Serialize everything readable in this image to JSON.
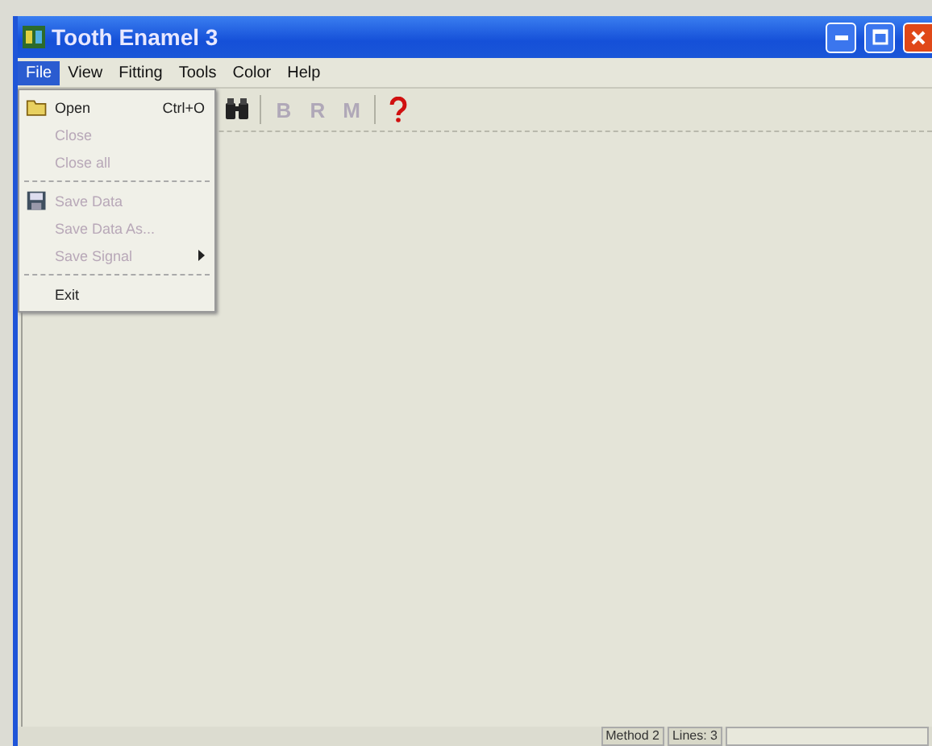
{
  "window": {
    "title": "Tooth Enamel 3"
  },
  "menu_bar": [
    {
      "label": "File",
      "selected": true
    },
    {
      "label": "View",
      "selected": false
    },
    {
      "label": "Fitting",
      "selected": false
    },
    {
      "label": "Tools",
      "selected": false
    },
    {
      "label": "Color",
      "selected": false
    },
    {
      "label": "Help",
      "selected": false
    }
  ],
  "toolbar": [
    {
      "kind": "binoculars"
    },
    {
      "kind": "separator"
    },
    {
      "kind": "letter",
      "label": "B",
      "disabled": true
    },
    {
      "kind": "letter",
      "label": "R",
      "disabled": true
    },
    {
      "kind": "letter",
      "label": "M",
      "disabled": true
    },
    {
      "kind": "separator"
    },
    {
      "kind": "help"
    }
  ],
  "file_menu": [
    {
      "kind": "folder",
      "label": "Open",
      "shortcut": "Ctrl+O",
      "disabled": false
    },
    {
      "kind": "item",
      "label": "Close",
      "disabled": true
    },
    {
      "kind": "item",
      "label": "Close all",
      "disabled": true
    },
    {
      "kind": "separator"
    },
    {
      "kind": "disk",
      "label": "Save Data",
      "disabled": true
    },
    {
      "kind": "item",
      "label": "Save Data As...",
      "disabled": true
    },
    {
      "kind": "item",
      "label": "Save Signal",
      "submenu": true,
      "disabled": true
    },
    {
      "kind": "separator"
    },
    {
      "kind": "item",
      "label": "Exit",
      "disabled": false
    }
  ],
  "status_bar": [
    "Method 2",
    "Lines: 3"
  ]
}
